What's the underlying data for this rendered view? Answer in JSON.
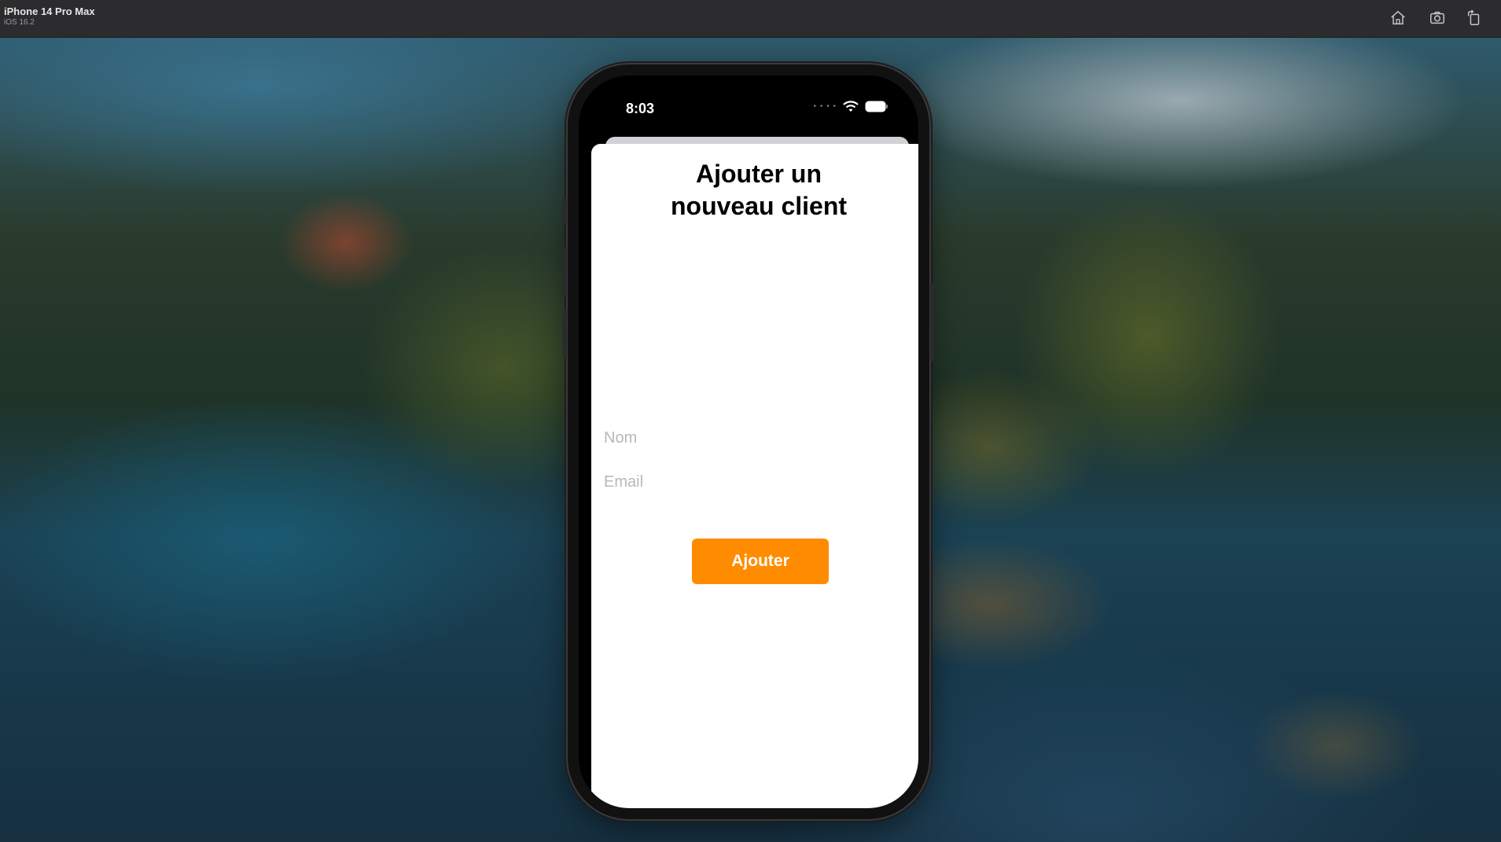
{
  "simulator": {
    "device_name": "iPhone 14 Pro Max",
    "os_version": "iOS 16.2",
    "toolbar_icons": [
      "home-icon",
      "screenshot-icon",
      "rotate-icon"
    ]
  },
  "status_bar": {
    "time": "8:03",
    "icons": [
      "wifi-icon",
      "battery-icon"
    ]
  },
  "screen": {
    "title": "Ajouter un\nnouveau client",
    "name_field": {
      "placeholder": "Nom",
      "value": ""
    },
    "email_field": {
      "placeholder": "Email",
      "value": ""
    },
    "add_button_label": "Ajouter"
  },
  "colors": {
    "accent": "#ff8c00",
    "titlebar": "#2c2c2e"
  }
}
